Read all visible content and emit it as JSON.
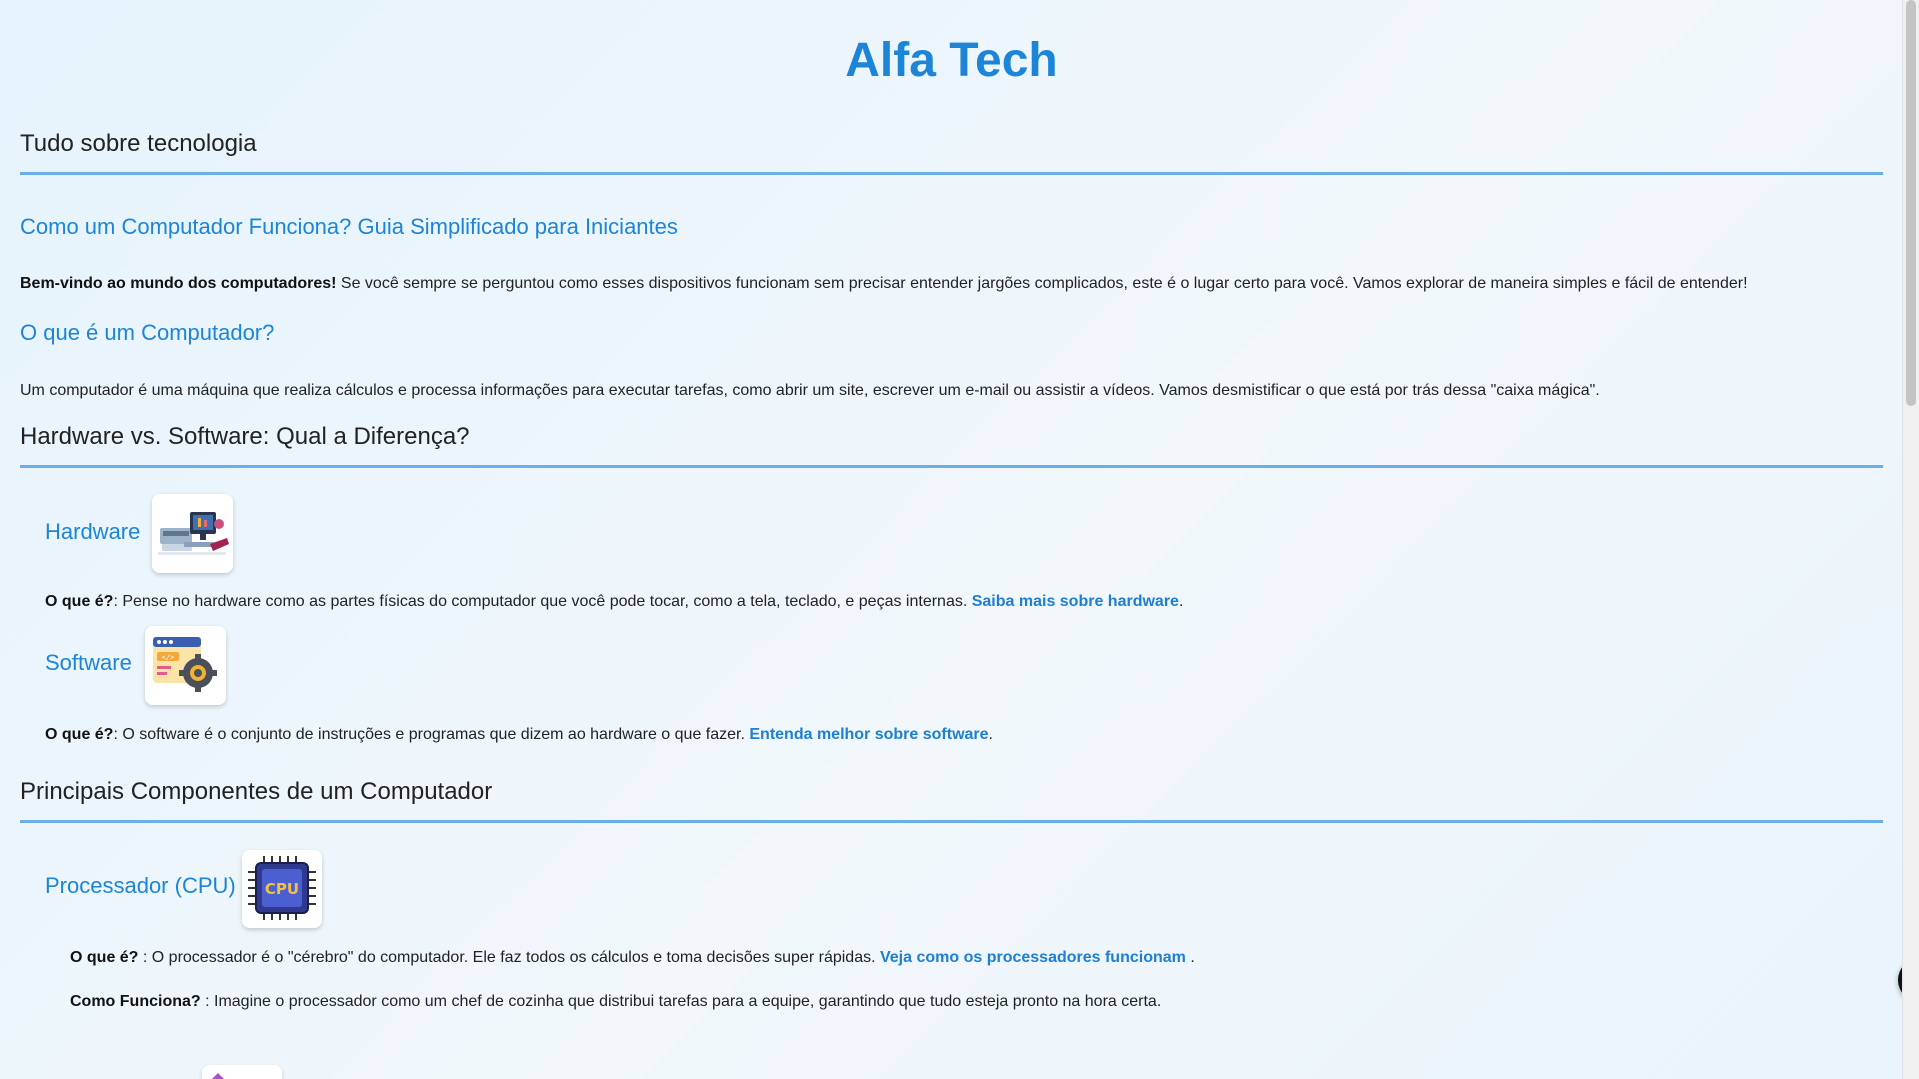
{
  "site": {
    "title": "Alfa Tech"
  },
  "section_tech": {
    "title": "Tudo sobre tecnologia"
  },
  "guide": {
    "title": "Como um Computador Funciona? Guia Simplificado para Iniciantes",
    "intro_bold": "Bem-vindo ao mundo dos computadores!",
    "intro_text": " Se você sempre se perguntou como esses dispositivos funcionam sem precisar entender jargões complicados, este é o lugar certo para você. Vamos explorar de maneira simples e fácil de entender!"
  },
  "what_is": {
    "title": "O que é um Computador?",
    "text": "Um computador é uma máquina que realiza cálculos e processa informações para executar tarefas, como abrir um site, escrever um e-mail ou assistir a vídeos. Vamos desmistificar o que está por trás dessa \"caixa mágica\"."
  },
  "hw_sw": {
    "title": "Hardware vs. Software: Qual a Diferença?",
    "hardware": {
      "title": "Hardware",
      "icon": "hardware-devices-icon",
      "label": "O que é?",
      "text": ": Pense no hardware como as partes físicas do computador que você pode tocar, como a tela, teclado, e peças internas. ",
      "link": "Saiba mais sobre hardware",
      "suffix": "."
    },
    "software": {
      "title": "Software",
      "icon": "software-gear-icon",
      "label": "O que é?",
      "text": ": O software é o conjunto de instruções e programas que dizem ao hardware o que fazer. ",
      "link": "Entenda melhor sobre software",
      "suffix": "."
    }
  },
  "components": {
    "title": "Principais Componentes de um Computador",
    "cpu": {
      "title": "Processador (CPU)",
      "icon": "cpu-chip-icon",
      "icon_text": "CPU",
      "what_label": "O que é?",
      "what_text": " : O processador é o \"cérebro\" do computador. Ele faz todos os cálculos e toma decisões super rápidas. ",
      "what_link": "Veja como os processadores funcionam",
      "what_suffix": " .",
      "how_label": "Como Funciona?",
      "how_text": " : Imagine o processador como um chef de cozinha que distribui tarefas para a equipe, garantindo que tudo esteja pronto na hora certa."
    }
  },
  "colors": {
    "accent": "#1c85d8",
    "rule": "#6aaeea",
    "background": "#e9f4fc"
  }
}
